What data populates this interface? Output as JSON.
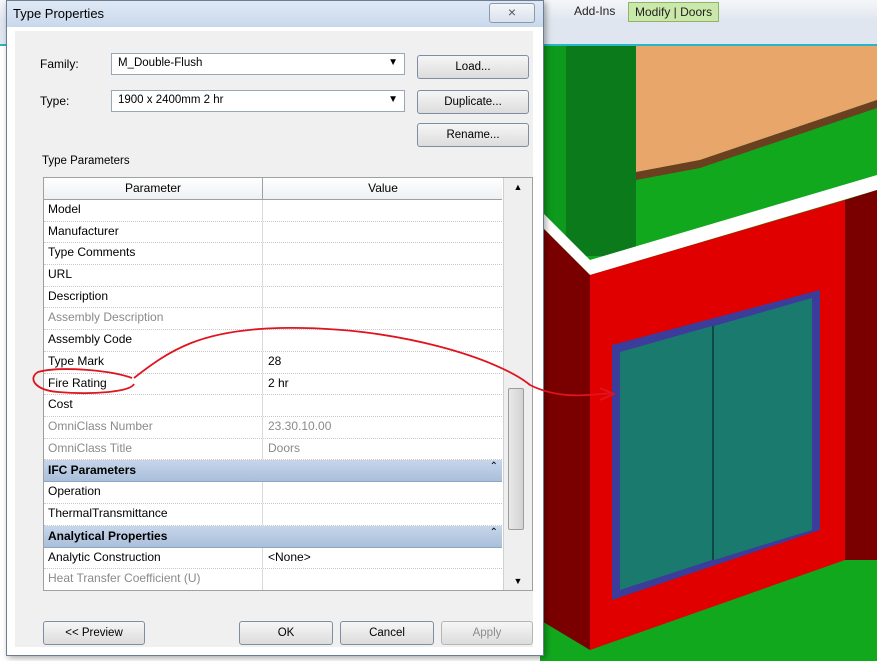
{
  "dialog": {
    "title": "Type Properties",
    "close_icon": "×"
  },
  "ribbon": {
    "addins_tab": "Add-Ins",
    "modify_tab": "Modify | Doors"
  },
  "family": {
    "label": "Family:",
    "value": "M_Double-Flush"
  },
  "type": {
    "label": "Type:",
    "value": "1900 x 2400mm 2 hr"
  },
  "buttons": {
    "load": "Load...",
    "duplicate": "Duplicate...",
    "rename": "Rename...",
    "preview": "<< Preview",
    "ok": "OK",
    "cancel": "Cancel",
    "apply": "Apply"
  },
  "type_parameters_label": "Type Parameters",
  "grid": {
    "header_parameter": "Parameter",
    "header_value": "Value",
    "rows": [
      {
        "p": "Model",
        "v": ""
      },
      {
        "p": "Manufacturer",
        "v": ""
      },
      {
        "p": "Type Comments",
        "v": ""
      },
      {
        "p": "URL",
        "v": ""
      },
      {
        "p": "Description",
        "v": ""
      },
      {
        "p": "Assembly Description",
        "v": ""
      },
      {
        "p": "Assembly Code",
        "v": ""
      },
      {
        "p": "Type Mark",
        "v": "28"
      },
      {
        "p": "Fire Rating",
        "v": "2 hr"
      },
      {
        "p": "Cost",
        "v": ""
      },
      {
        "p": "OmniClass Number",
        "v": "23.30.10.00"
      },
      {
        "p": "OmniClass Title",
        "v": "Doors"
      }
    ],
    "group_ifc": "IFC Parameters",
    "ifc_rows": [
      {
        "p": "Operation",
        "v": ""
      },
      {
        "p": "ThermalTransmittance",
        "v": ""
      }
    ],
    "group_analytical": "Analytical Properties",
    "analytical_rows": [
      {
        "p": "Analytic Construction",
        "v": "<None>"
      },
      {
        "p": "Heat Transfer Coefficient (U)",
        "v": ""
      }
    ]
  },
  "icons": {
    "dropdown": "chevron-down-icon",
    "collapse": "double-chevron-up-icon",
    "scroll_up": "scroll-up-arrow-icon",
    "scroll_down": "scroll-down-arrow-icon"
  },
  "colors": {
    "annotation": "#e0141e",
    "wall": "#e00000",
    "floor": "#12a81e",
    "door_panel": "#1b7a6e"
  }
}
